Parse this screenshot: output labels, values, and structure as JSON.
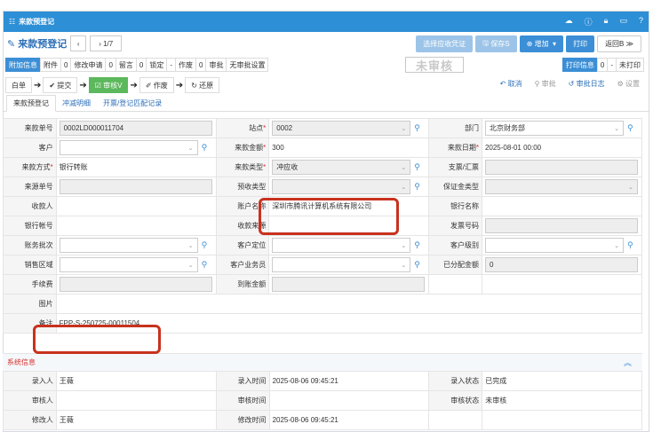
{
  "window": {
    "title": "来款预登记"
  },
  "title_icons": [
    "cloud-icon",
    "info-icon",
    "lock-icon",
    "window-icon",
    "help-icon"
  ],
  "header": {
    "page_title": "来款预登记",
    "pager": "1/7"
  },
  "actions": {
    "voucher": "选择应收凭证",
    "save": "保存S",
    "add": "增加",
    "print": "打印",
    "back": "返回B ≫"
  },
  "info_bar": [
    {
      "label": "附加信息",
      "highlight": true
    },
    {
      "label": "附件"
    },
    {
      "label": "0"
    },
    {
      "label": "修改申请"
    },
    {
      "label": "0"
    },
    {
      "label": "留言"
    },
    {
      "label": "0"
    },
    {
      "label": "锁定"
    },
    {
      "label": "-"
    },
    {
      "label": "作废"
    },
    {
      "label": "0"
    },
    {
      "label": "审批"
    },
    {
      "label": "无审批设置"
    }
  ],
  "stamp": "未审核",
  "print_info": {
    "label": "打印信息",
    "count": "0",
    "dash": "-",
    "status": "未打印"
  },
  "workflow": {
    "steps": [
      "白单",
      "提交",
      "审核V",
      "作废",
      "还原"
    ]
  },
  "right_actions": {
    "cancel": "取消",
    "approve": "审批",
    "log": "审批日志",
    "settings": "设置"
  },
  "tabs": [
    "来款预登记",
    "冲减明细",
    "开票/登记匹配记录"
  ],
  "form": {
    "receipt_no_label": "来款单号",
    "receipt_no": "0002LD000011704",
    "site_label": "站点",
    "site": "0002",
    "dept_label": "部门",
    "dept": "北京财务部",
    "customer_label": "客户",
    "customer": "",
    "amount_label": "来款金额",
    "amount": "300",
    "date_label": "来款日期",
    "date": "2025-08-01 00:00",
    "method_label": "来款方式",
    "method": "银行转账",
    "type_label": "来款类型",
    "type": "冲应收",
    "check_label": "支票/汇票",
    "check": "",
    "source_no_label": "来源单号",
    "source_no": "",
    "prepay_label": "预收类型",
    "prepay": "",
    "deposit_label": "保证金类型",
    "deposit": "",
    "payee_label": "收款人",
    "payee": "",
    "account_name_label": "账户名称",
    "account_name": "深圳市腾讯计算机系统有限公司",
    "bank_name_label": "银行名称",
    "bank_name": "",
    "bank_account_label": "银行帐号",
    "bank_account": "",
    "receipt_source_label": "收款来源",
    "receipt_source": "",
    "invoice_no_label": "发票号码",
    "invoice_no": "",
    "batch_label": "账务批次",
    "batch": "",
    "cust_pos_label": "客户定位",
    "cust_pos": "",
    "cust_level_label": "客户级别",
    "cust_level": "",
    "region_label": "销售区域",
    "region": "",
    "salesman_label": "客户业务员",
    "salesman": "",
    "allocated_label": "已分配金额",
    "allocated": "0",
    "fee_label": "手续费",
    "fee": "",
    "received_label": "到账金额",
    "received": "",
    "picture_label": "图片",
    "remark_label": "备注",
    "remark": "FPP-S-250725-00011504"
  },
  "system": {
    "section_title": "系统信息",
    "entered_by_label": "录入人",
    "entered_by": "王薇",
    "entered_time_label": "录入时间",
    "entered_time": "2025-08-06 09:45:21",
    "entry_status_label": "录入状态",
    "entry_status": "已完成",
    "reviewer_label": "审核人",
    "reviewer": "",
    "review_time_label": "审核时间",
    "review_time": "",
    "review_status_label": "审核状态",
    "review_status": "未审核",
    "modifier_label": "修改人",
    "modifier": "王薇",
    "modify_time_label": "修改时间",
    "modify_time": "2025-08-06 09:45:21"
  }
}
